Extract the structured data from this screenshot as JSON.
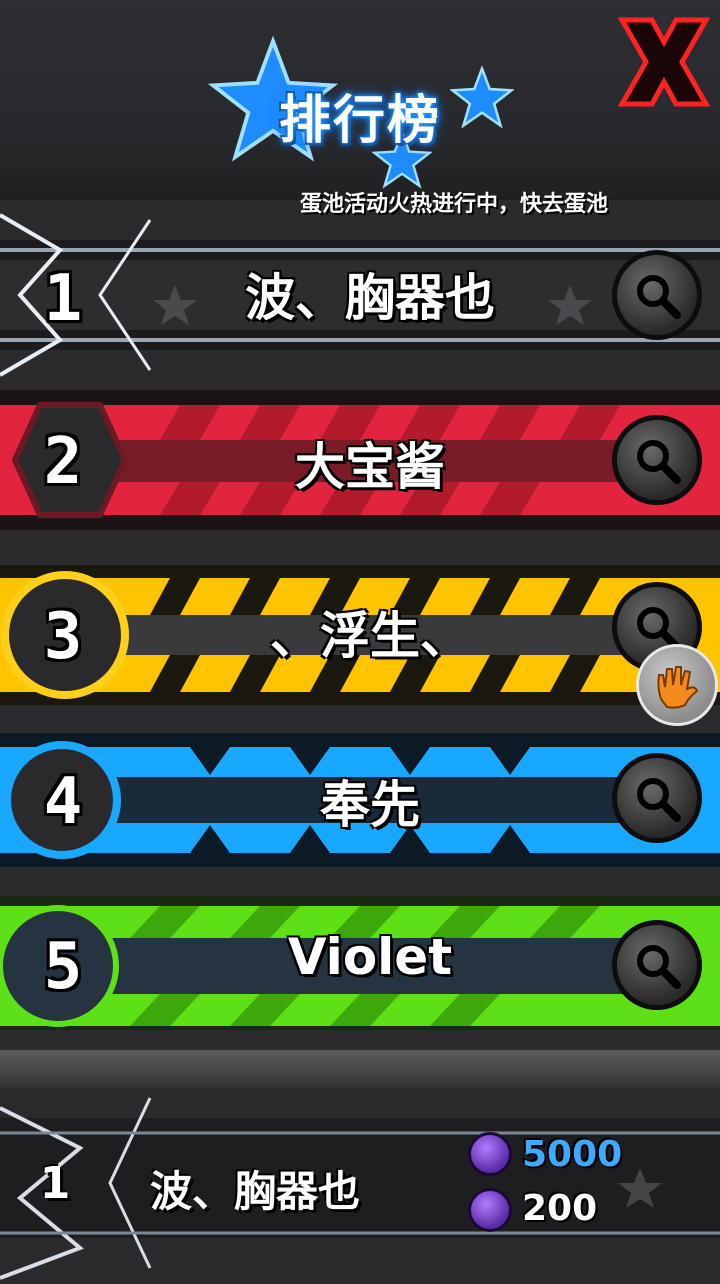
{
  "header": {
    "title": "排行榜",
    "ticker": "蛋池活动火热进行中，快去蛋池"
  },
  "ranking": [
    {
      "rank": "1",
      "name": "波、胸器也",
      "theme": "dark",
      "color": "#cfd3d9"
    },
    {
      "rank": "2",
      "name": "大宝酱",
      "theme": "red",
      "color": "#e2243f"
    },
    {
      "rank": "3",
      "name": "、浮生、",
      "theme": "yellow",
      "color": "#ffc400"
    },
    {
      "rank": "4",
      "name": "奉先",
      "theme": "blue",
      "color": "#18a8ff"
    },
    {
      "rank": "5",
      "name": "Violet",
      "theme": "green",
      "color": "#5ee018"
    }
  ],
  "my_entry": {
    "rank": "1",
    "name": "波、胸器也",
    "score_primary": "5000",
    "score_secondary": "200",
    "score_primary_color": "#3fa9ff",
    "score_secondary_color": "#ffffff"
  },
  "icons": {
    "close": "close-x-icon",
    "view": "magnifier-icon",
    "float": "hand-icon",
    "currency": "purple-coin-icon"
  }
}
